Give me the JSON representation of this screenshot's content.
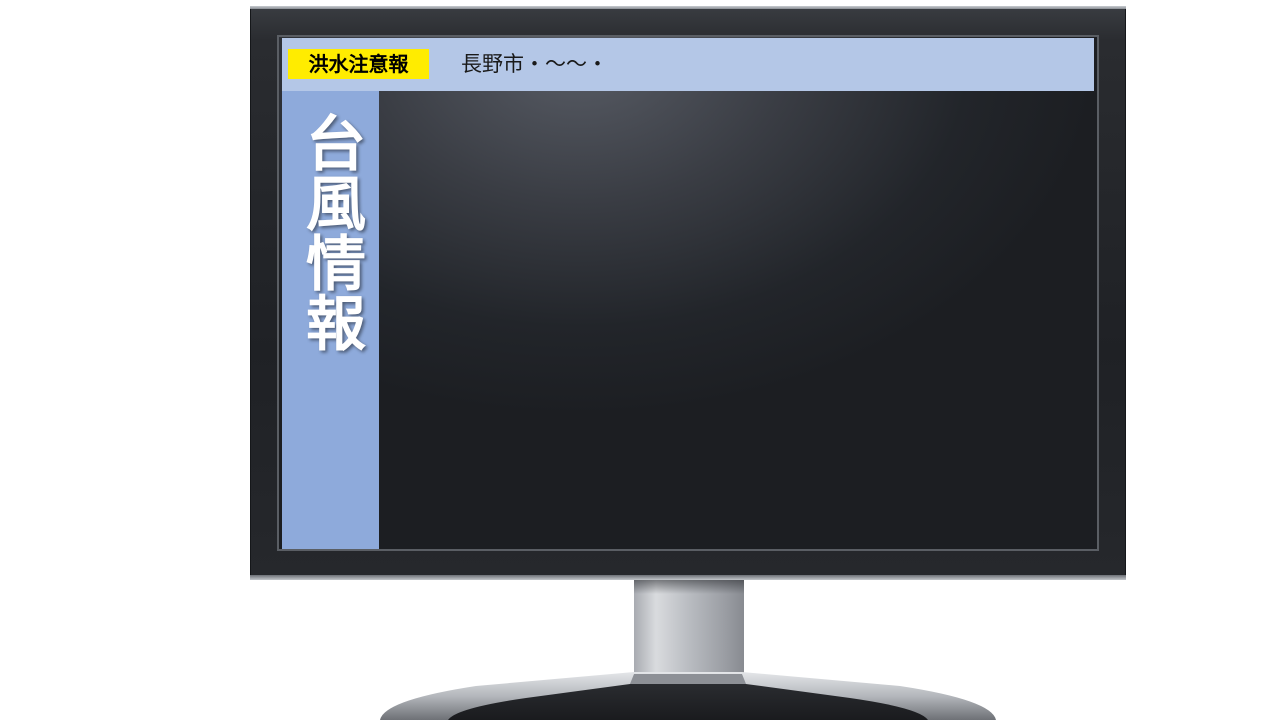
{
  "alert": {
    "label": "洪水注意報",
    "color": "#ffec00"
  },
  "ticker": {
    "text": "長野市・～～・"
  },
  "sidebar": {
    "title": "台風情報",
    "color": "#8eaadb"
  },
  "header": {
    "color": "#b4c7e7"
  },
  "device": {
    "type": "monitor-icon"
  }
}
